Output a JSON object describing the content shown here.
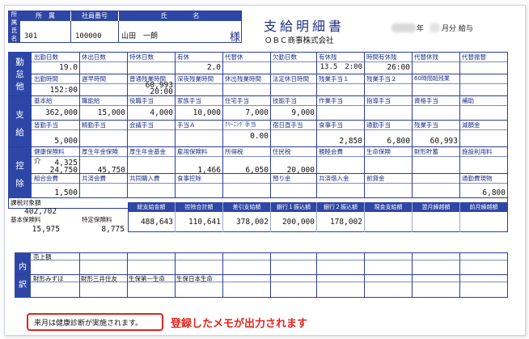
{
  "header": {
    "side_labels": [
      "所",
      "属",
      "氏",
      "名"
    ],
    "col_dept": "所　属",
    "col_empno": "社員番号",
    "col_name": "氏　　　　名",
    "dept": "301",
    "empno": "100000",
    "name": "山田　一朗",
    "honorific": "様",
    "title": "支給明細書",
    "year_suffix": "年",
    "month_suffix": "月分 給与",
    "company": "ＯＢＣ商事株式会社"
  },
  "attendance": {
    "side": [
      "勤",
      "怠",
      "他"
    ],
    "row1_labels": [
      "出勤日数",
      "休出日数",
      "特休日数",
      "有休",
      "代替休",
      "欠勤日数",
      "有休残",
      "時間有休残",
      "代替休残",
      "代替振替"
    ],
    "row1_values": [
      "19.0",
      "",
      "",
      "2.0",
      "",
      "",
      "13.5　2:00",
      "26:00",
      "",
      ""
    ],
    "row2_labels": [
      "出勤時間",
      "遅早時間",
      "普通残業時間",
      "深夜残業時間",
      "休出残業時間",
      "法定休日時間",
      "残業手当１",
      "残業手当２",
      "60時間超残業",
      ""
    ],
    "row2_top_value": "60,993",
    "row2_values": [
      "152:00",
      "",
      "20:00",
      "",
      "",
      "",
      "",
      "",
      "",
      ""
    ]
  },
  "payment": {
    "side": [
      "支",
      "給"
    ],
    "row1_labels": [
      "基本給",
      "職能給",
      "役職手当",
      "家族手当",
      "住宅手当",
      "技能手当",
      "作業手当",
      "指導手当",
      "資格手当",
      "補助"
    ],
    "row1_values": [
      "362,000",
      "15,000",
      "4,000",
      "10,000",
      "7,000",
      "9,000",
      "",
      "",
      "",
      ""
    ],
    "row1b_value": "0.00",
    "row2_labels": [
      "皆勤手当",
      "精勤手当",
      "会議手当",
      "手当Ａ",
      "ｸﾘｰﾆﾝｸﾞ手当",
      "宿日直手当",
      "食事手当",
      "通勤手当",
      "残業手当",
      "減額金"
    ],
    "row2_values": [
      "5,000",
      "",
      "",
      "",
      "",
      "",
      "2,850",
      "6,800",
      "60,993",
      ""
    ]
  },
  "deduction": {
    "side": [
      "控",
      "除"
    ],
    "row1_labels": [
      "健康保険料",
      "厚生年金保険",
      "厚生年金基金",
      "雇用保険料",
      "所得税",
      "住民税",
      "親睦会費",
      "生命保険",
      "財形貯蓄",
      "施設利用料"
    ],
    "care_label": "介",
    "care_value": "4,325",
    "row1_values": [
      "24,750",
      "45,750",
      "",
      "1,466",
      "6,050",
      "20,000",
      "",
      "",
      "",
      ""
    ],
    "row2_labels": [
      "組合会費",
      "共済会費",
      "共同購入費",
      "食事控除",
      "",
      "預り金",
      "共済借入金",
      "前貸金",
      "",
      "通勤費現物"
    ],
    "row2_values": [
      "1,500",
      "",
      "",
      "",
      "",
      "",
      "",
      "",
      "",
      "6,800"
    ]
  },
  "totals": {
    "taxable_label": "課税対象額",
    "taxable_value": "402,702",
    "std_ins_label": "基本保険料",
    "std_ins_value": "15,975",
    "special_ins_label": "特定保険料",
    "special_ins_value": "8,775",
    "headers": [
      "総支給金額",
      "控除合計額",
      "差引支給額",
      "銀行１振込額",
      "銀行２振込額",
      "現金支給額",
      "翌月繰越額",
      "前月繰越額"
    ],
    "values": [
      "488,643",
      "110,641",
      "378,002",
      "200,000",
      "178,002",
      "",
      "",
      ""
    ]
  },
  "detail": {
    "side_top": "内",
    "side_bottom": "訳",
    "row1_labels": [
      "売上額",
      "",
      "",
      "",
      "",
      "",
      "",
      "",
      "",
      ""
    ],
    "row2_labels": [
      "財形みずほ",
      "財形三井住友",
      "生保第一生命",
      "生保日本生命",
      "",
      "",
      "",
      "",
      "",
      ""
    ]
  },
  "memo": {
    "text": "来月は健康診断が実施されます。",
    "annotation": "登録したメモが出力されます",
    "border_color": "#e0241c"
  }
}
